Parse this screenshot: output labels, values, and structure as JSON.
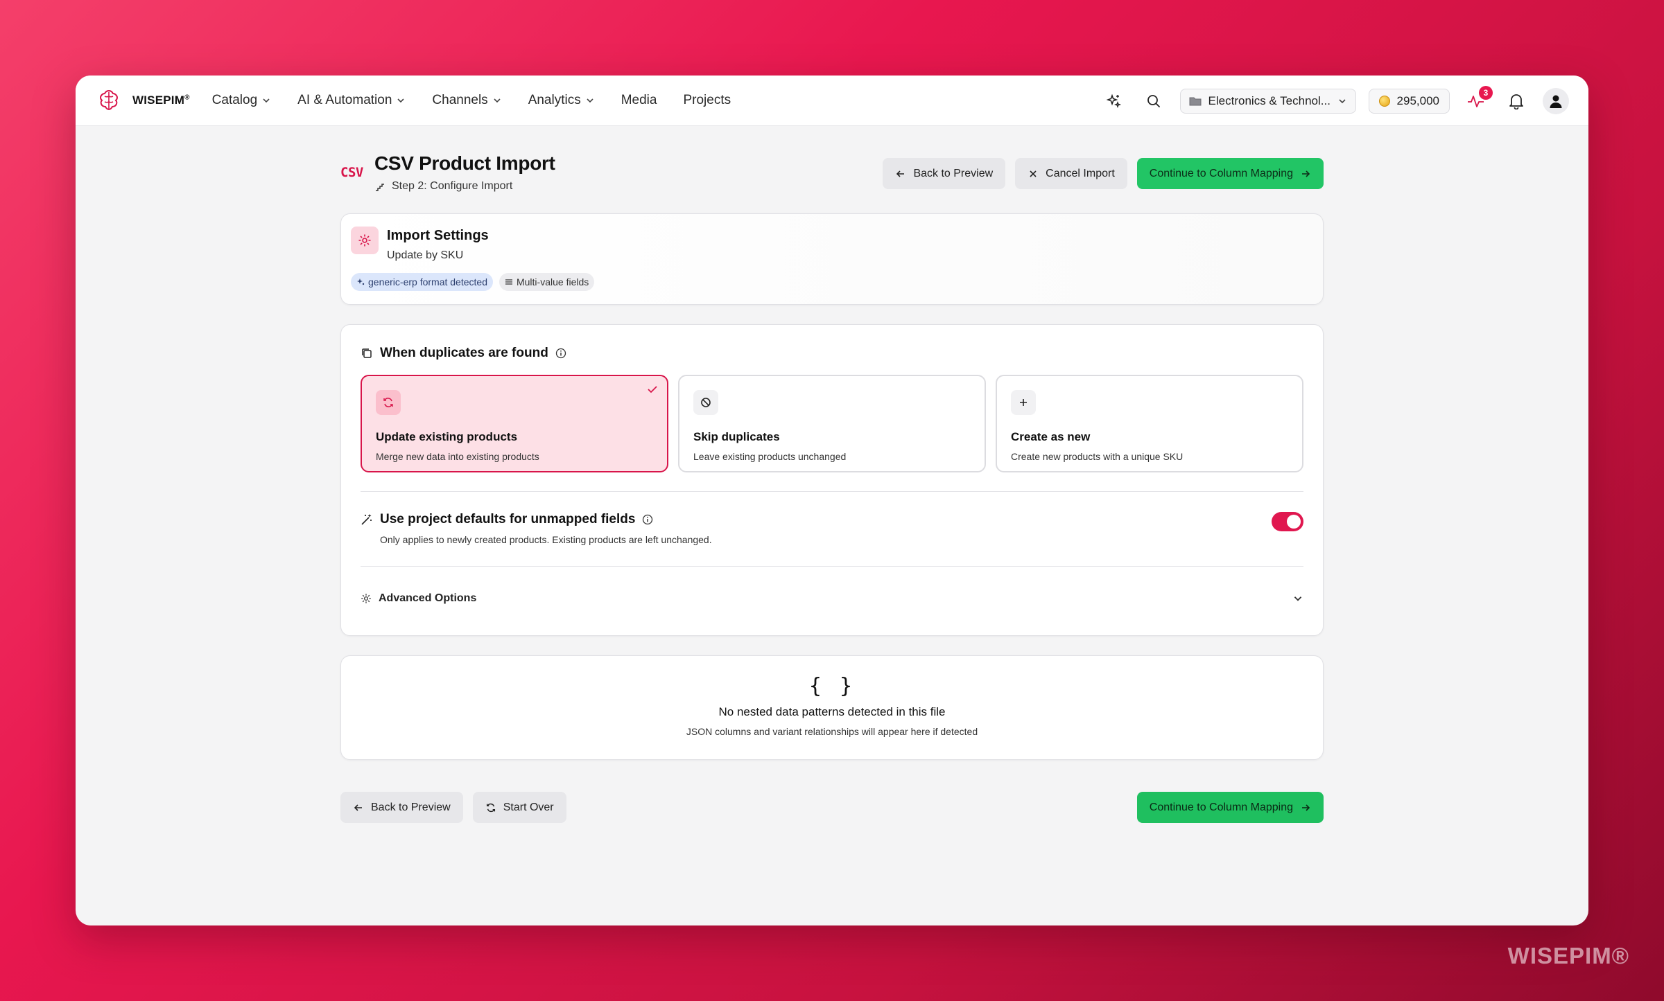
{
  "app": {
    "brand": "WISEPIM",
    "brand_mark": "®"
  },
  "nav": {
    "items": [
      {
        "label": "Catalog",
        "has_dropdown": true
      },
      {
        "label": "AI & Automation",
        "has_dropdown": true
      },
      {
        "label": "Channels",
        "has_dropdown": true
      },
      {
        "label": "Analytics",
        "has_dropdown": true
      },
      {
        "label": "Media",
        "has_dropdown": false
      },
      {
        "label": "Projects",
        "has_dropdown": false
      }
    ],
    "workspace": "Electronics & Technol...",
    "credits": "295,000",
    "activity_badge": "3"
  },
  "page": {
    "logo_text": "CSV",
    "title": "CSV Product Import",
    "step": "Step 2: Configure Import",
    "back_label": "Back to Preview",
    "cancel_label": "Cancel Import",
    "continue_label": "Continue to Column Mapping"
  },
  "settings": {
    "title": "Import Settings",
    "subtitle": "Update by SKU",
    "chips": [
      "generic-erp format detected",
      "Multi-value fields"
    ]
  },
  "duplicates": {
    "heading": "When duplicates are found",
    "options": [
      {
        "title": "Update existing products",
        "desc": "Merge new data into existing products",
        "selected": true
      },
      {
        "title": "Skip duplicates",
        "desc": "Leave existing products unchanged",
        "selected": false
      },
      {
        "title": "Create as new",
        "desc": "Create new products with a unique SKU",
        "selected": false
      }
    ],
    "defaults_title": "Use project defaults for unmapped fields",
    "defaults_desc": "Only applies to newly created products. Existing products are left unchanged.",
    "defaults_enabled": true,
    "advanced_label": "Advanced Options"
  },
  "nested": {
    "symbol": "{ }",
    "title": "No nested data patterns detected in this file",
    "desc": "JSON columns and variant relationships will appear here if detected"
  },
  "footer": {
    "back_label": "Back to Preview",
    "start_over_label": "Start Over",
    "continue_label": "Continue to Column Mapping"
  },
  "watermark": "WISEPIM®",
  "colors": {
    "accent": "#d8154a",
    "success": "#22c565",
    "background_gradient_start": "#f43f6a",
    "background_gradient_end": "#8f0a2c"
  }
}
